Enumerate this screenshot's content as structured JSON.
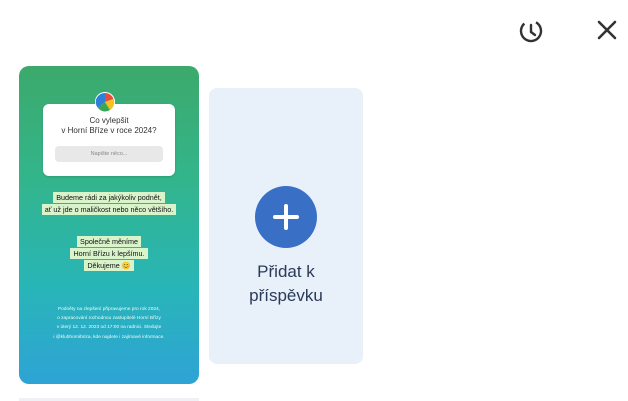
{
  "header": {
    "history_icon": "history-timer-icon",
    "close_icon": "close-icon"
  },
  "story": {
    "question_line1": "Co vylepšit",
    "question_line2": "v Horní Bříze v roce 2024?",
    "input_placeholder": "Napište něco...",
    "line1": "Budeme rádi za jakýkoliv podnět,",
    "line2": "ať už jde o maličkost nebo něco většího.",
    "line3": "Společně měníme",
    "line4": "Horní Břízu k lepšímu.",
    "line5": "Děkujeme 😊",
    "small1": "Podněty na zlepšení připravujeme pro rok 2024,",
    "small2": "o zapracování rozhodnou zastupitelé Horní Břízy",
    "small3": "v úterý 12. 12. 2023 od 17:00 na radnici. Sledujte",
    "small4": "i @klubhornibriza, kde najdete i zajímavé informace."
  },
  "add_card": {
    "label_line1": "Přidat k",
    "label_line2": "příspěvku"
  },
  "colors": {
    "accent": "#3a6fc6",
    "card_bg": "#e8f0fa"
  }
}
